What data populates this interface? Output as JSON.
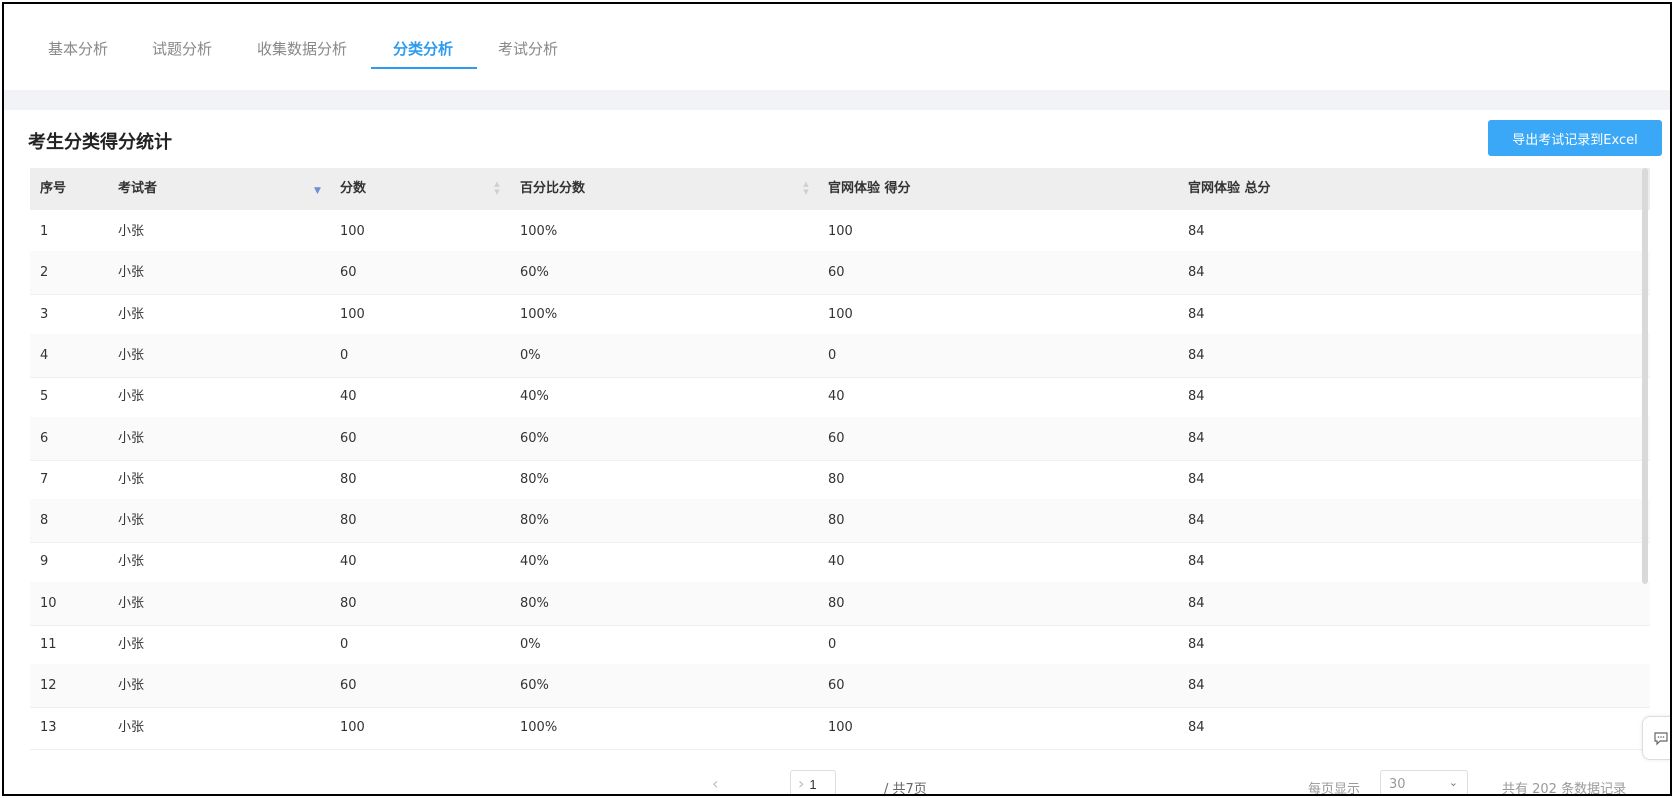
{
  "tabs": [
    {
      "label": "基本分析",
      "active": false
    },
    {
      "label": "试题分析",
      "active": false
    },
    {
      "label": "收集数据分析",
      "active": false
    },
    {
      "label": "分类分析",
      "active": true
    },
    {
      "label": "考试分析",
      "active": false
    }
  ],
  "panel": {
    "title": "考生分类得分统计",
    "export_label": "导出考试记录到Excel"
  },
  "table": {
    "columns": [
      "序号",
      "考试者",
      "分数",
      "百分比分数",
      "官网体验 得分",
      "官网体验 总分"
    ],
    "rows": [
      [
        "1",
        "小张",
        "100",
        "100%",
        "100",
        "84"
      ],
      [
        "2",
        "小张",
        "60",
        "60%",
        "60",
        "84"
      ],
      [
        "3",
        "小张",
        "100",
        "100%",
        "100",
        "84"
      ],
      [
        "4",
        "小张",
        "0",
        "0%",
        "0",
        "84"
      ],
      [
        "5",
        "小张",
        "40",
        "40%",
        "40",
        "84"
      ],
      [
        "6",
        "小张",
        "60",
        "60%",
        "60",
        "84"
      ],
      [
        "7",
        "小张",
        "80",
        "80%",
        "80",
        "84"
      ],
      [
        "8",
        "小张",
        "80",
        "80%",
        "80",
        "84"
      ],
      [
        "9",
        "小张",
        "40",
        "40%",
        "40",
        "84"
      ],
      [
        "10",
        "小张",
        "80",
        "80%",
        "80",
        "84"
      ],
      [
        "11",
        "小张",
        "0",
        "0%",
        "0",
        "84"
      ],
      [
        "12",
        "小张",
        "60",
        "60%",
        "60",
        "84"
      ],
      [
        "13",
        "小张",
        "100",
        "100%",
        "100",
        "84"
      ]
    ]
  },
  "pagination": {
    "prev_icon": "chevron-left-icon",
    "next_icon": "chevron-right-icon",
    "current_page": "1",
    "total_pages_text": "/ 共7页",
    "per_page_label": "每页显示",
    "per_page_value": "30",
    "total_records_text": "共有 202 条数据记录"
  },
  "colors": {
    "accent": "#2d9cf0",
    "button": "#3aa8f6"
  }
}
